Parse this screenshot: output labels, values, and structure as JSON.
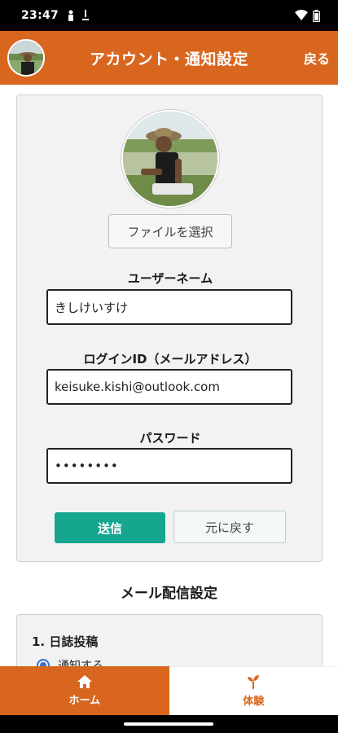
{
  "status": {
    "time": "23:47"
  },
  "header": {
    "title": "アカウント・通知設定",
    "back_label": "戻る"
  },
  "profile": {
    "file_button": "ファイルを選択"
  },
  "form": {
    "username_label": "ユーザーネーム",
    "username_value": "きしけいすけ",
    "login_label": "ログインID（メールアドレス）",
    "login_value": "keisuke.kishi@outlook.com",
    "password_label": "パスワード",
    "password_value": "••••••••",
    "submit_label": "送信",
    "reset_label": "元に戻す"
  },
  "mail": {
    "section_title": "メール配信設定",
    "item1_heading": "1. 日誌投稿",
    "item1_option": "通知する"
  },
  "nav": {
    "home_label": "ホーム",
    "experience_label": "体験"
  },
  "colors": {
    "brand_orange": "#d9661e",
    "accent_teal": "#16a58e"
  },
  "icons": [
    "wifi-icon",
    "battery-icon",
    "home-icon",
    "sprout-icon"
  ]
}
